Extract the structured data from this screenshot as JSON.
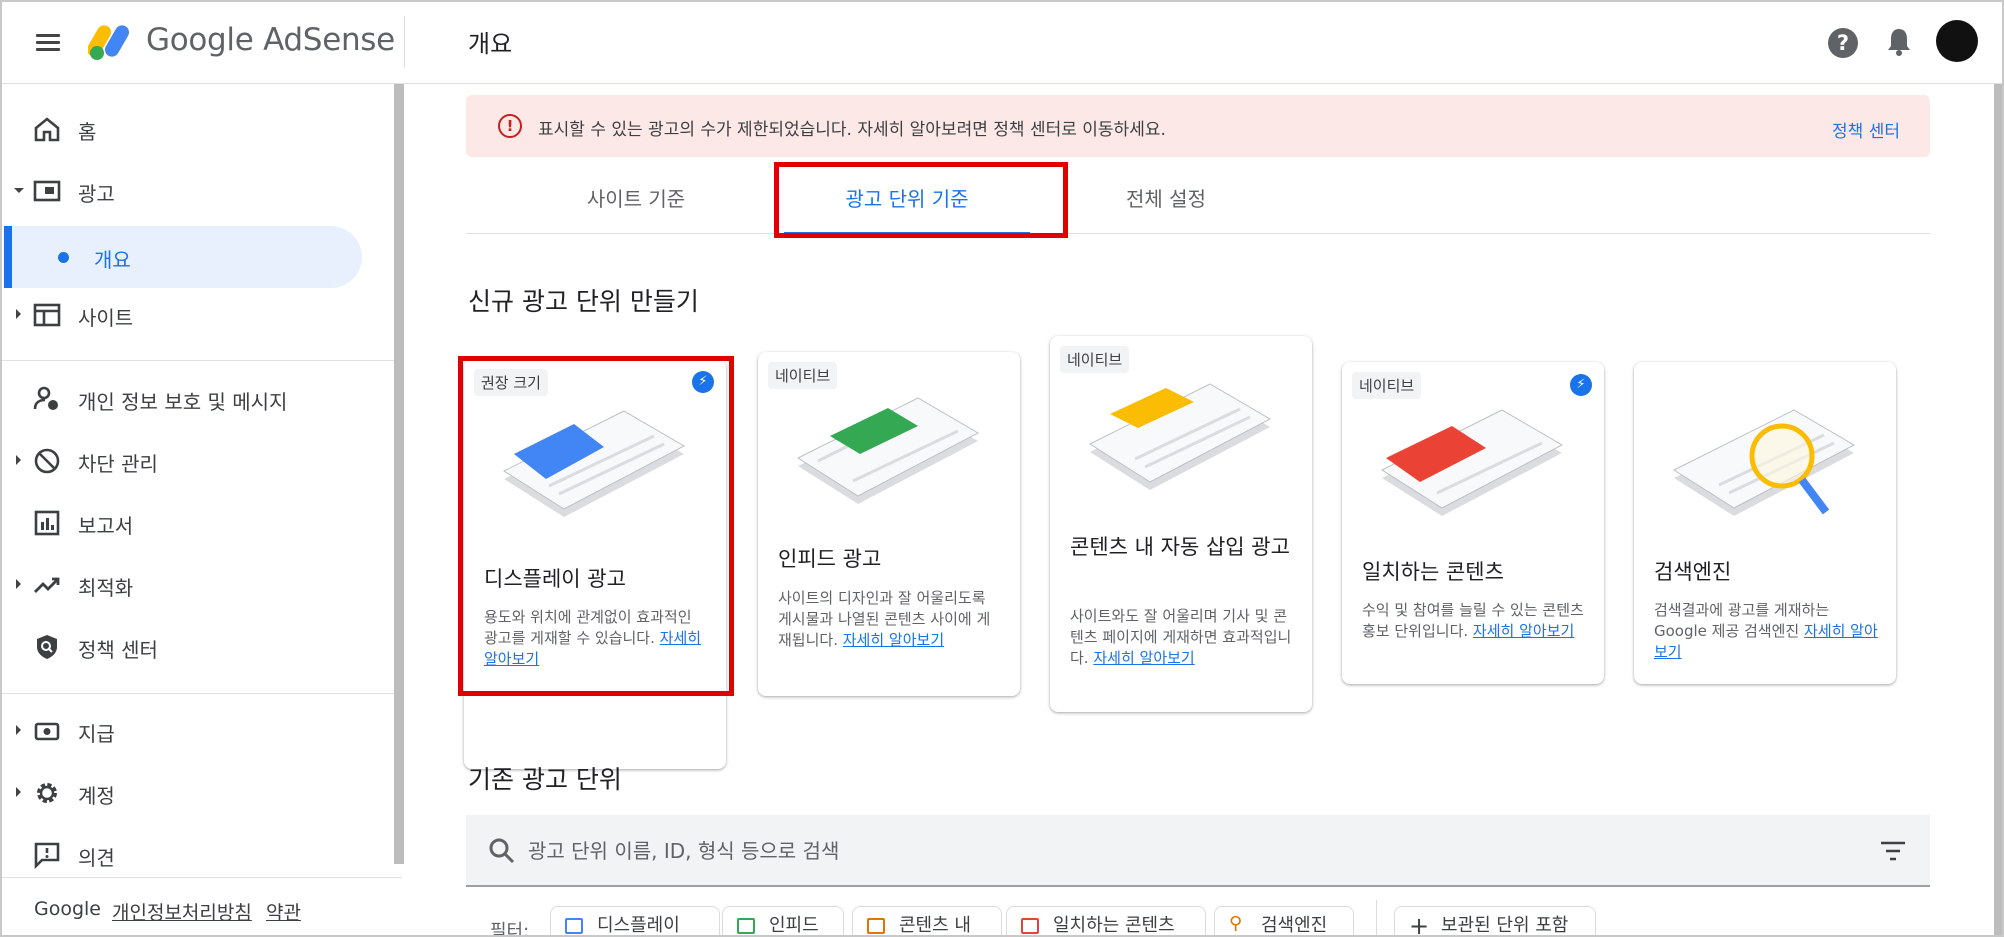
{
  "app": {
    "name": "Google AdSense",
    "page_title": "개요"
  },
  "header": {
    "help_icon": "help-circle-icon",
    "notifications_icon": "bell-icon",
    "avatar_icon": "account-avatar"
  },
  "sidebar": {
    "items": [
      {
        "label": "홈",
        "icon": "home-icon"
      },
      {
        "label": "광고",
        "icon": "ads-icon"
      },
      {
        "label": "개요",
        "active": true
      },
      {
        "label": "사이트",
        "icon": "sites-icon"
      },
      {
        "label": "개인 정보 보호 및 메시지",
        "icon": "privacy-icon"
      },
      {
        "label": "차단 관리",
        "icon": "block-icon"
      },
      {
        "label": "보고서",
        "icon": "reports-icon"
      },
      {
        "label": "최적화",
        "icon": "trending-icon"
      },
      {
        "label": "정책 센터",
        "icon": "policy-shield-icon"
      },
      {
        "label": "지급",
        "icon": "payments-icon"
      },
      {
        "label": "계정",
        "icon": "gear-icon"
      },
      {
        "label": "의견",
        "icon": "feedback-icon"
      }
    ],
    "footer": {
      "brand": "Google",
      "privacy": "개인정보처리방침",
      "terms": "약관"
    }
  },
  "alert": {
    "text": "표시할 수 있는 광고의 수가 제한되었습니다. 자세히 알아보려면 정책 센터로 이동하세요.",
    "link": "정책 센터",
    "color": "#fce8e6"
  },
  "tabs": [
    {
      "label": "사이트 기준"
    },
    {
      "label": "광고 단위 기준",
      "active": true
    },
    {
      "label": "전체 설정"
    }
  ],
  "new_units": {
    "heading": "신규 광고 단위 만들기",
    "cards": [
      {
        "badge": "권장 크기",
        "title": "디스플레이 광고",
        "desc": "용도와 위치에 관계없이 효과적인 광고를 게재할 수 있습니다.",
        "link": "자세히 알아보기",
        "accent": "#4285f4"
      },
      {
        "badge": "네이티브",
        "title": "인피드 광고",
        "desc": "사이트의 디자인과 잘 어울리도록 게시물과 나열된 콘텐츠 사이에 게재됩니다.",
        "link": "자세히 알아보기",
        "accent": "#34a853"
      },
      {
        "badge": "네이티브",
        "title": "콘텐츠 내 자동 삽입 광고",
        "desc": "사이트와도 잘 어울리며 기사 및 콘텐츠 페이지에 게재하면 효과적입니다.",
        "link": "자세히 알아보기",
        "accent": "#fbbc04"
      },
      {
        "badge": "네이티브",
        "title": "일치하는 콘텐츠",
        "desc": "수익 및 참여를 늘릴 수 있는 콘텐츠 홍보 단위입니다.",
        "link": "자세히 알아보기",
        "accent": "#ea4335"
      },
      {
        "title": "검색엔진",
        "desc": "검색결과에 광고를 게재하는 Google 제공 검색엔진",
        "link": "자세히 알아보기",
        "accent": "#fbbc04"
      }
    ]
  },
  "existing_units": {
    "heading": "기존 광고 단위",
    "search_placeholder": "광고 단위 이름, ID, 형식 등으로 검색",
    "filter_label": "필터:",
    "chips": [
      "디스플레이",
      "인피드",
      "콘텐츠 내",
      "일치하는 콘텐츠",
      "검색엔진"
    ],
    "archived_chip": "보관된 단위 포함"
  }
}
